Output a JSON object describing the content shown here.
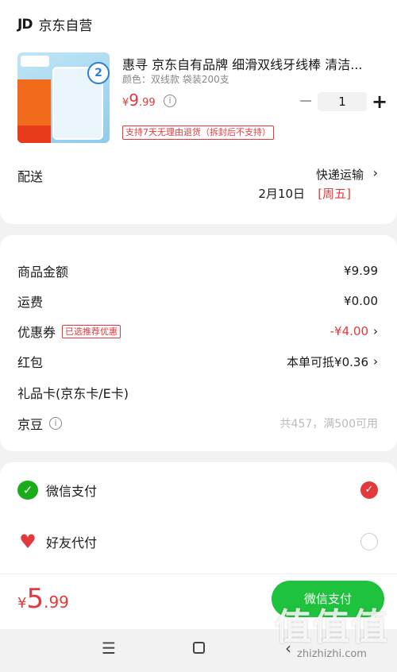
{
  "store": {
    "logo": "JD",
    "name": "京东自营"
  },
  "product": {
    "title": "惠寻 京东自有品牌 细滑双线牙线棒 清洁...",
    "spec": "颜色：双线款  袋装200支",
    "price_symbol": "¥",
    "price_int": "9",
    "price_dec": ".99",
    "quantity": "1",
    "minus_label": "−",
    "plus_label": "+",
    "return_policy": "支持7天无理由退货（拆封后不支持）",
    "image_badge": "2"
  },
  "delivery": {
    "label": "配送",
    "method": "快递运输",
    "date": "2月10日",
    "weekday": "[周五]"
  },
  "summary": {
    "goods_label": "商品金额",
    "goods_value": "¥9.99",
    "shipping_label": "运费",
    "shipping_value": "¥0.00",
    "coupon_label": "优惠券",
    "coupon_tag": "已选推荐优惠",
    "coupon_value": "-¥4.00",
    "redpacket_label": "红包",
    "redpacket_value": "本单可抵¥0.36",
    "giftcard_label": "礼品卡(京东卡/E卡)",
    "jingdou_label": "京豆",
    "jingdou_value": "共457，满500可用"
  },
  "payment": {
    "wechat_label": "微信支付",
    "friend_label": "好友代付"
  },
  "bottom": {
    "total_symbol": "¥",
    "total_int": "5",
    "total_dec": ".99",
    "pay_button": "微信支付"
  },
  "watermark": {
    "glyphs": "值值值",
    "url": "zhizhizhi.com"
  },
  "colors": {
    "accent": "#e4393c",
    "wechat_green": "#1ec23c",
    "background": "#f2f2f2"
  }
}
